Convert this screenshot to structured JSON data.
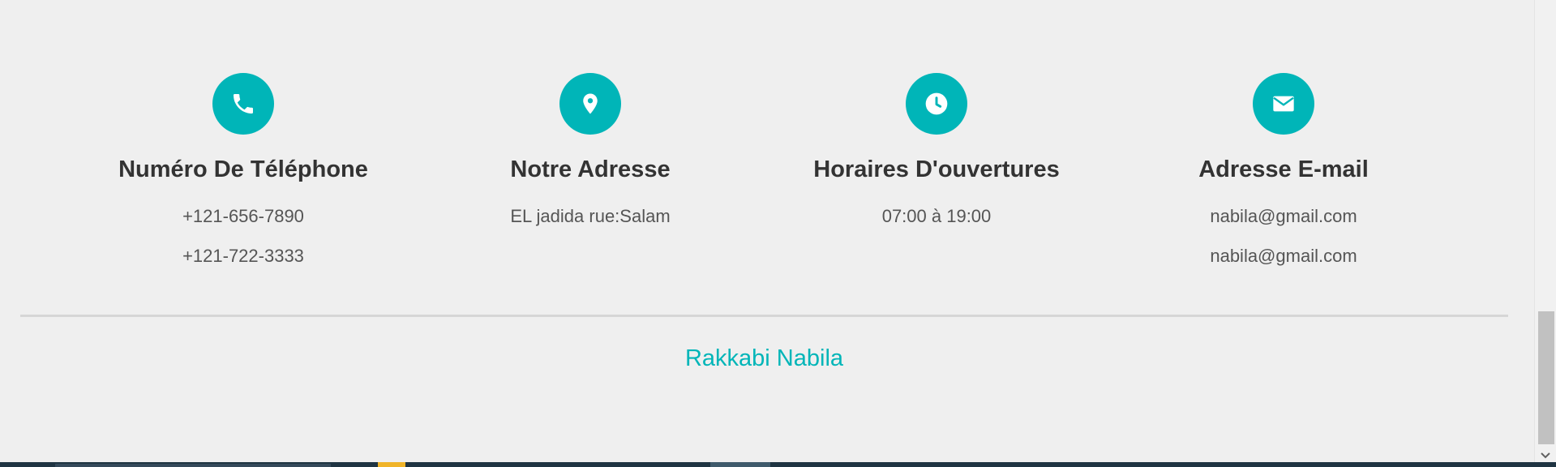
{
  "colors": {
    "accent": "#00b5b8",
    "background": "#efefef",
    "title": "#333333",
    "text": "#555555",
    "divider": "#d6d6d6"
  },
  "contact": {
    "phone": {
      "icon": "phone-icon",
      "title": "Numéro De Téléphone",
      "lines": [
        "+121-656-7890",
        "+121-722-3333"
      ]
    },
    "address": {
      "icon": "map-pin-icon",
      "title": "Notre Adresse",
      "lines": [
        "EL jadida rue:Salam"
      ]
    },
    "hours": {
      "icon": "clock-icon",
      "title": "Horaires D'ouvertures",
      "lines": [
        "07:00 à 19:00"
      ]
    },
    "email": {
      "icon": "envelope-icon",
      "title": "Adresse E-mail",
      "lines": [
        "nabila@gmail.com",
        "nabila@gmail.com"
      ]
    }
  },
  "footer": {
    "name": "Rakkabi Nabila"
  }
}
